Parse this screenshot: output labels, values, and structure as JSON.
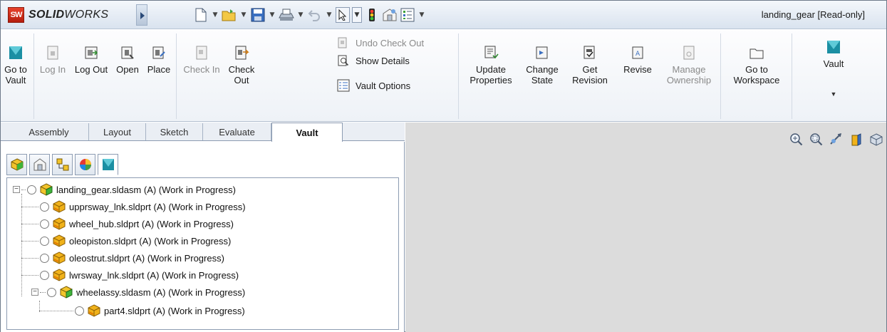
{
  "app": {
    "brand_bold": "SOLID",
    "brand_rest": "WORKS",
    "badge": "SW",
    "document_title": "landing_gear [Read-only]"
  },
  "quick_access": {
    "icons": [
      "new-document-icon",
      "open-folder-icon",
      "save-icon",
      "print-icon",
      "undo-icon",
      "select-pointer-icon",
      "traffic-light-icon",
      "options-icon",
      "list-icon"
    ]
  },
  "ribbon": {
    "go_to_vault": [
      "Go to",
      "Vault"
    ],
    "log_in": "Log In",
    "log_out": "Log Out",
    "open": "Open",
    "place": "Place",
    "check_in": "Check In",
    "check_out": [
      "Check",
      "Out"
    ],
    "undo_check_out": "Undo Check Out",
    "show_details": "Show Details",
    "vault_options": "Vault Options",
    "update_properties": [
      "Update",
      "Properties"
    ],
    "change_state": [
      "Change",
      "State"
    ],
    "get_revision": [
      "Get",
      "Revision"
    ],
    "revise": "Revise",
    "manage_ownership": [
      "Manage",
      "Ownership"
    ],
    "go_to_workspace": [
      "Go to",
      "Workspace"
    ],
    "vault": "Vault"
  },
  "tabs": [
    {
      "label": "Assembly"
    },
    {
      "label": "Layout"
    },
    {
      "label": "Sketch"
    },
    {
      "label": "Evaluate"
    },
    {
      "label": "Vault",
      "active": true
    }
  ],
  "panel_tabs": [
    "feature-manager-icon",
    "property-manager-icon",
    "configuration-manager-icon",
    "appearance-icon",
    "vault-icon"
  ],
  "tree": [
    {
      "label": "landing_gear.sldasm (A) (Work in Progress)",
      "level": 0,
      "type": "assembly",
      "expander": "−"
    },
    {
      "label": "upprsway_lnk.sldprt (A) (Work in Progress)",
      "level": 1,
      "type": "part"
    },
    {
      "label": "wheel_hub.sldprt (A) (Work in Progress)",
      "level": 1,
      "type": "part"
    },
    {
      "label": "oleopiston.sldprt (A) (Work in Progress)",
      "level": 1,
      "type": "part"
    },
    {
      "label": "oleostrut.sldprt (A) (Work in Progress)",
      "level": 1,
      "type": "part"
    },
    {
      "label": "lwrsway_lnk.sldprt (A) (Work in Progress)",
      "level": 1,
      "type": "part"
    },
    {
      "label": "wheelassy.sldasm (A) (Work in Progress)",
      "level": 1,
      "type": "assembly",
      "expander": "−"
    },
    {
      "label": "part4.sldprt (A) (Work in Progress)",
      "level": 2,
      "type": "part"
    }
  ],
  "view_tools": [
    "zoom-to-fit-icon",
    "zoom-to-area-icon",
    "previous-view-icon",
    "section-view-icon",
    "view-orientation-icon"
  ],
  "colors": {
    "brand_red": "#d0311c",
    "vault_teal": "#1b8fa3",
    "graphics_bg": "#dcdcdc",
    "assembly_green": "#3fb43a",
    "part_yellow": "#f0b21a"
  }
}
